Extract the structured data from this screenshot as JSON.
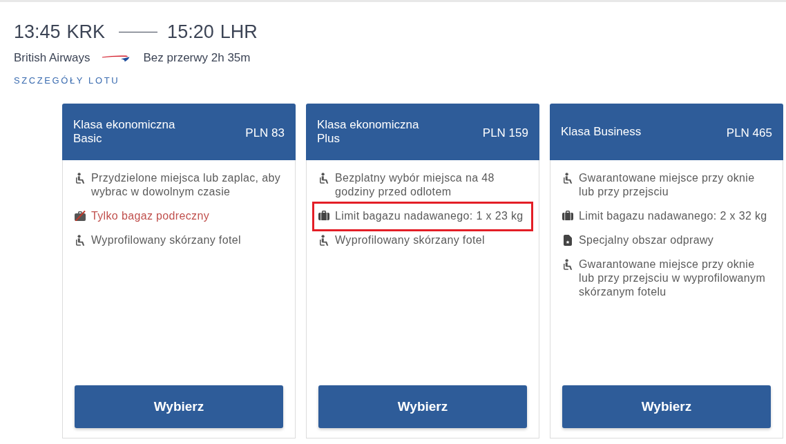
{
  "flight": {
    "departure_time": "13:45",
    "departure_airport": "KRK",
    "arrival_time": "15:20",
    "arrival_airport": "LHR",
    "airline": "British Airways",
    "duration": "Bez przerwy 2h 35m",
    "details_link": "SZCZEGÓŁY LOTU"
  },
  "fare_cards": [
    {
      "title": "Klasa ekonomiczna Basic",
      "price": "PLN 83",
      "features": [
        {
          "kind": "seat",
          "text": "Przydzielone miejsca lub zaplac, aby wybrac w dowolnym czasie",
          "highlighted": false
        },
        {
          "kind": "no_baggage",
          "text": "Tylko bagaz podreczny",
          "highlighted": false
        },
        {
          "kind": "seat",
          "text": "Wyprofilowany skórzany fotel",
          "highlighted": false
        }
      ],
      "button": "Wybierz"
    },
    {
      "title": "Klasa ekonomiczna Plus",
      "price": "PLN 159",
      "features": [
        {
          "kind": "seat",
          "text": "Bezplatny wybór miejsca na 48 godziny przed odlotem",
          "highlighted": false
        },
        {
          "kind": "baggage",
          "text": "Limit bagazu nadawanego: 1 x 23 kg",
          "highlighted": true
        },
        {
          "kind": "seat",
          "text": "Wyprofilowany skórzany fotel",
          "highlighted": false
        }
      ],
      "button": "Wybierz"
    },
    {
      "title": "Klasa Business",
      "price": "PLN 465",
      "features": [
        {
          "kind": "seat",
          "text": "Gwarantowane miejsce przy oknie lub przy przejsciu",
          "highlighted": false
        },
        {
          "kind": "baggage",
          "text": "Limit bagazu nadawanego: 2 x 32 kg",
          "highlighted": false
        },
        {
          "kind": "checkin",
          "text": "Specjalny obszar odprawy",
          "highlighted": false
        },
        {
          "kind": "seat",
          "text": "Gwarantowane miejsce przy oknie lub przy przejsciu w wyprofilowanym skórzanym fotelu",
          "highlighted": false
        }
      ],
      "button": "Wybierz"
    }
  ]
}
